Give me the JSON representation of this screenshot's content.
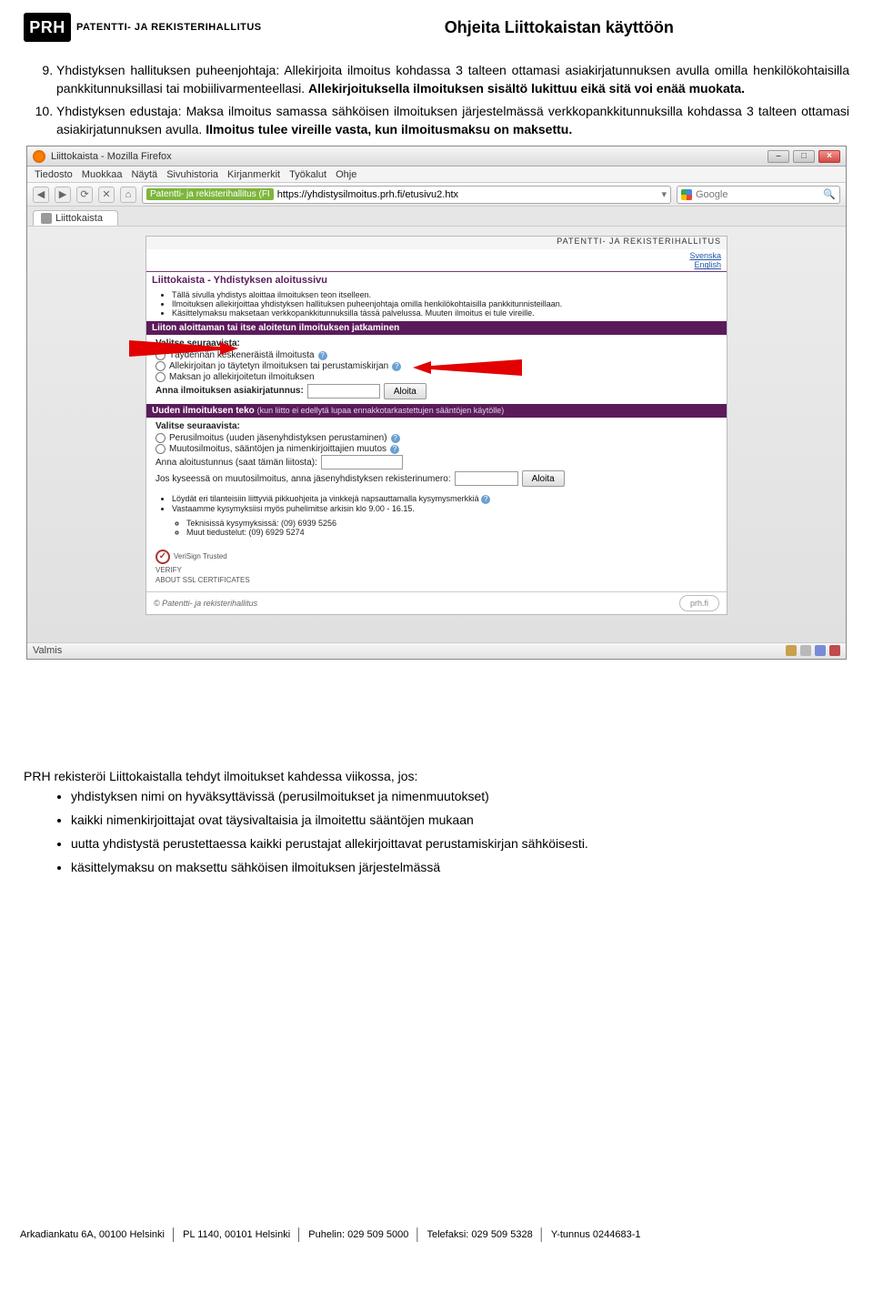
{
  "header": {
    "logo_box": "PRH",
    "logo_text": "PATENTTI- JA REKISTERIHALLITUS",
    "title": "Ohjeita Liittokaistan käyttöön"
  },
  "instructions": {
    "start": 9,
    "items": [
      {
        "plain": "Yhdistyksen hallituksen puheenjohtaja: Allekirjoita ilmoitus kohdassa 3 talteen ottamasi asiakirjatunnuksen avulla omilla henkilökohtaisilla pankkitunnuksillasi tai mobiilivarmenteellasi. ",
        "bold": "Allekirjoituksella ilmoituksen sisältö lukittuu eikä sitä voi enää muokata."
      },
      {
        "plain": "Yhdistyksen edustaja: Maksa ilmoitus samassa sähköisen ilmoituksen järjestelmässä verkkopankkitunnuksilla kohdassa 3 talteen ottamasi asiakirjatunnuksen avulla. ",
        "bold": "Ilmoitus tulee vireille vasta, kun ilmoitusmaksu on maksettu."
      }
    ]
  },
  "browser": {
    "window_title": "Liittokaista - Mozilla Firefox",
    "menus": [
      "Tiedosto",
      "Muokkaa",
      "Näytä",
      "Sivuhistoria",
      "Kirjanmerkit",
      "Työkalut",
      "Ohje"
    ],
    "site_badge": "Patentti- ja rekisterihallitus (FI",
    "url": "https://yhdistysilmoitus.prh.fi/etusivu2.htx",
    "search_placeholder": "Google",
    "tab_label": "Liittokaista",
    "status": "Valmis"
  },
  "panel": {
    "topstrip": "PATENTTI- JA REKISTERIHALLITUS",
    "lang_links": [
      "Svenska",
      "English"
    ],
    "title": "Liittokaista - Yhdistyksen aloitussivu",
    "intro_bullets": [
      "Tällä sivulla yhdistys aloittaa ilmoituksen teon itselleen.",
      "Ilmoituksen allekirjoittaa yhdistyksen hallituksen puheenjohtaja omilla henkilökohtaisilla pankkitunnisteillaan.",
      "Käsittelymaksu maksetaan verkkopankkitunnuksilla tässä palvelussa. Muuten ilmoitus ei tule vireille."
    ],
    "section1_title": "Liiton aloittaman tai itse aloitetun ilmoituksen jatkaminen",
    "section1_label": "Valitse seuraavista:",
    "section1_radios": [
      "Täydennän keskeneräistä ilmoitusta",
      "Allekirjoitan jo täytetyn ilmoituksen tai perustamiskirjan",
      "Maksan jo allekirjoitetun ilmoituksen"
    ],
    "section1_field_label": "Anna ilmoituksen asiakirjatunnus:",
    "section1_button": "Aloita",
    "section2_title": "Uuden ilmoituksen teko",
    "section2_title_note": "(kun liitto ei edellytä lupaa ennakkotarkastettujen sääntöjen käytölle)",
    "section2_label": "Valitse seuraavista:",
    "section2_radios": [
      "Perusilmoitus (uuden jäsenyhdistyksen perustaminen)",
      "Muutosilmoitus, sääntöjen ja nimenkirjoittajien muutos"
    ],
    "section2_field_label": "Anna aloitustunnus (saat tämän liitosta):",
    "section2_line": "Jos kyseessä on muutosilmoitus, anna jäsenyhdistyksen rekisterinumero:",
    "section2_button": "Aloita",
    "tips_bullets": [
      "Löydät eri tilanteisiin liittyviä pikkuohjeita ja vinkkejä napsauttamalla kysymysmerkkiä",
      "Vastaamme kysymyksiisi myös puhelimitse arkisin klo 9.00 - 16.15."
    ],
    "tips_sub": [
      "Teknisissä kysymyksissä: (09) 6939 5256",
      "Muut tiedustelut: (09) 6929 5274"
    ],
    "verisign": "VeriSign Trusted",
    "verisign_sub1": "VERIFY",
    "verisign_sub2": "ABOUT SSL CERTIFICATES",
    "footer_copy": "© Patentti- ja rekisterihallitus",
    "footer_oval": "prh.fi"
  },
  "post": {
    "lead": "PRH rekisteröi Liittokaistalla tehdyt ilmoitukset kahdessa viikossa, jos:",
    "items": [
      "yhdistyksen nimi on hyväksyttävissä (perusilmoitukset ja nimenmuutokset)",
      "kaikki nimenkirjoittajat ovat täysivaltaisia ja ilmoitettu sääntöjen mukaan",
      "uutta yhdistystä perustettaessa kaikki perustajat allekirjoittavat perustamiskirjan sähköisesti.",
      "käsittelymaksu on maksettu sähköisen ilmoituksen järjestelmässä"
    ]
  },
  "footer": {
    "c1": "Arkadiankatu 6A, 00100 Helsinki",
    "c2": "PL 1140, 00101 Helsinki",
    "c3": "Puhelin: 029 509 5000",
    "c4": "Telefaksi: 029 509 5328",
    "c5": "Y-tunnus 0244683-1"
  }
}
